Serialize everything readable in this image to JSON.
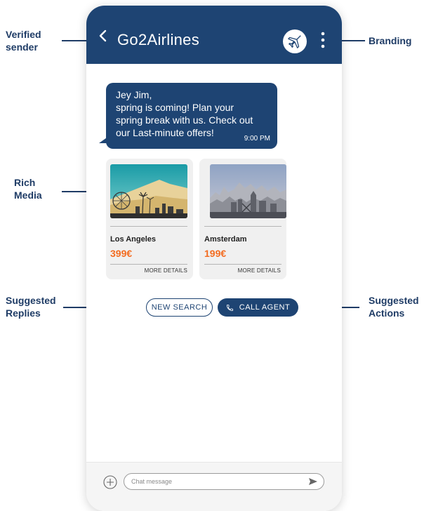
{
  "callouts": {
    "verified_sender": "Verified\nsender",
    "branding": "Branding",
    "rich_media": "Rich\nMedia",
    "suggested_replies": "Suggested\nReplies",
    "suggested_actions": "Suggested\nActions"
  },
  "header": {
    "title": "Go2Airlines",
    "logo_icon": "airplane-icon",
    "background": "#1e4473"
  },
  "message": {
    "text": "Jey Jim,\nspring is coming! Plan your\nspring break with us. Check out\nour Last-minute offers!",
    "time": "9:00 PM"
  },
  "cards": [
    {
      "city": "Los Angeles",
      "price": "399€",
      "more": "MORE DETAILS",
      "image": "los-angeles-skyline"
    },
    {
      "city": "Amsterdam",
      "price": "199€",
      "more": "MORE DETAILS",
      "image": "amsterdam-skyline"
    }
  ],
  "suggestions": {
    "reply_label": "NEW SEARCH",
    "action_label": "CALL AGENT",
    "action_icon": "phone-icon"
  },
  "composer": {
    "placeholder": "Chat message",
    "add_icon": "plus-circle-icon",
    "send_icon": "send-icon"
  },
  "colors": {
    "brand": "#1e4473",
    "price": "#f36c21",
    "label": "#1f3c66"
  }
}
